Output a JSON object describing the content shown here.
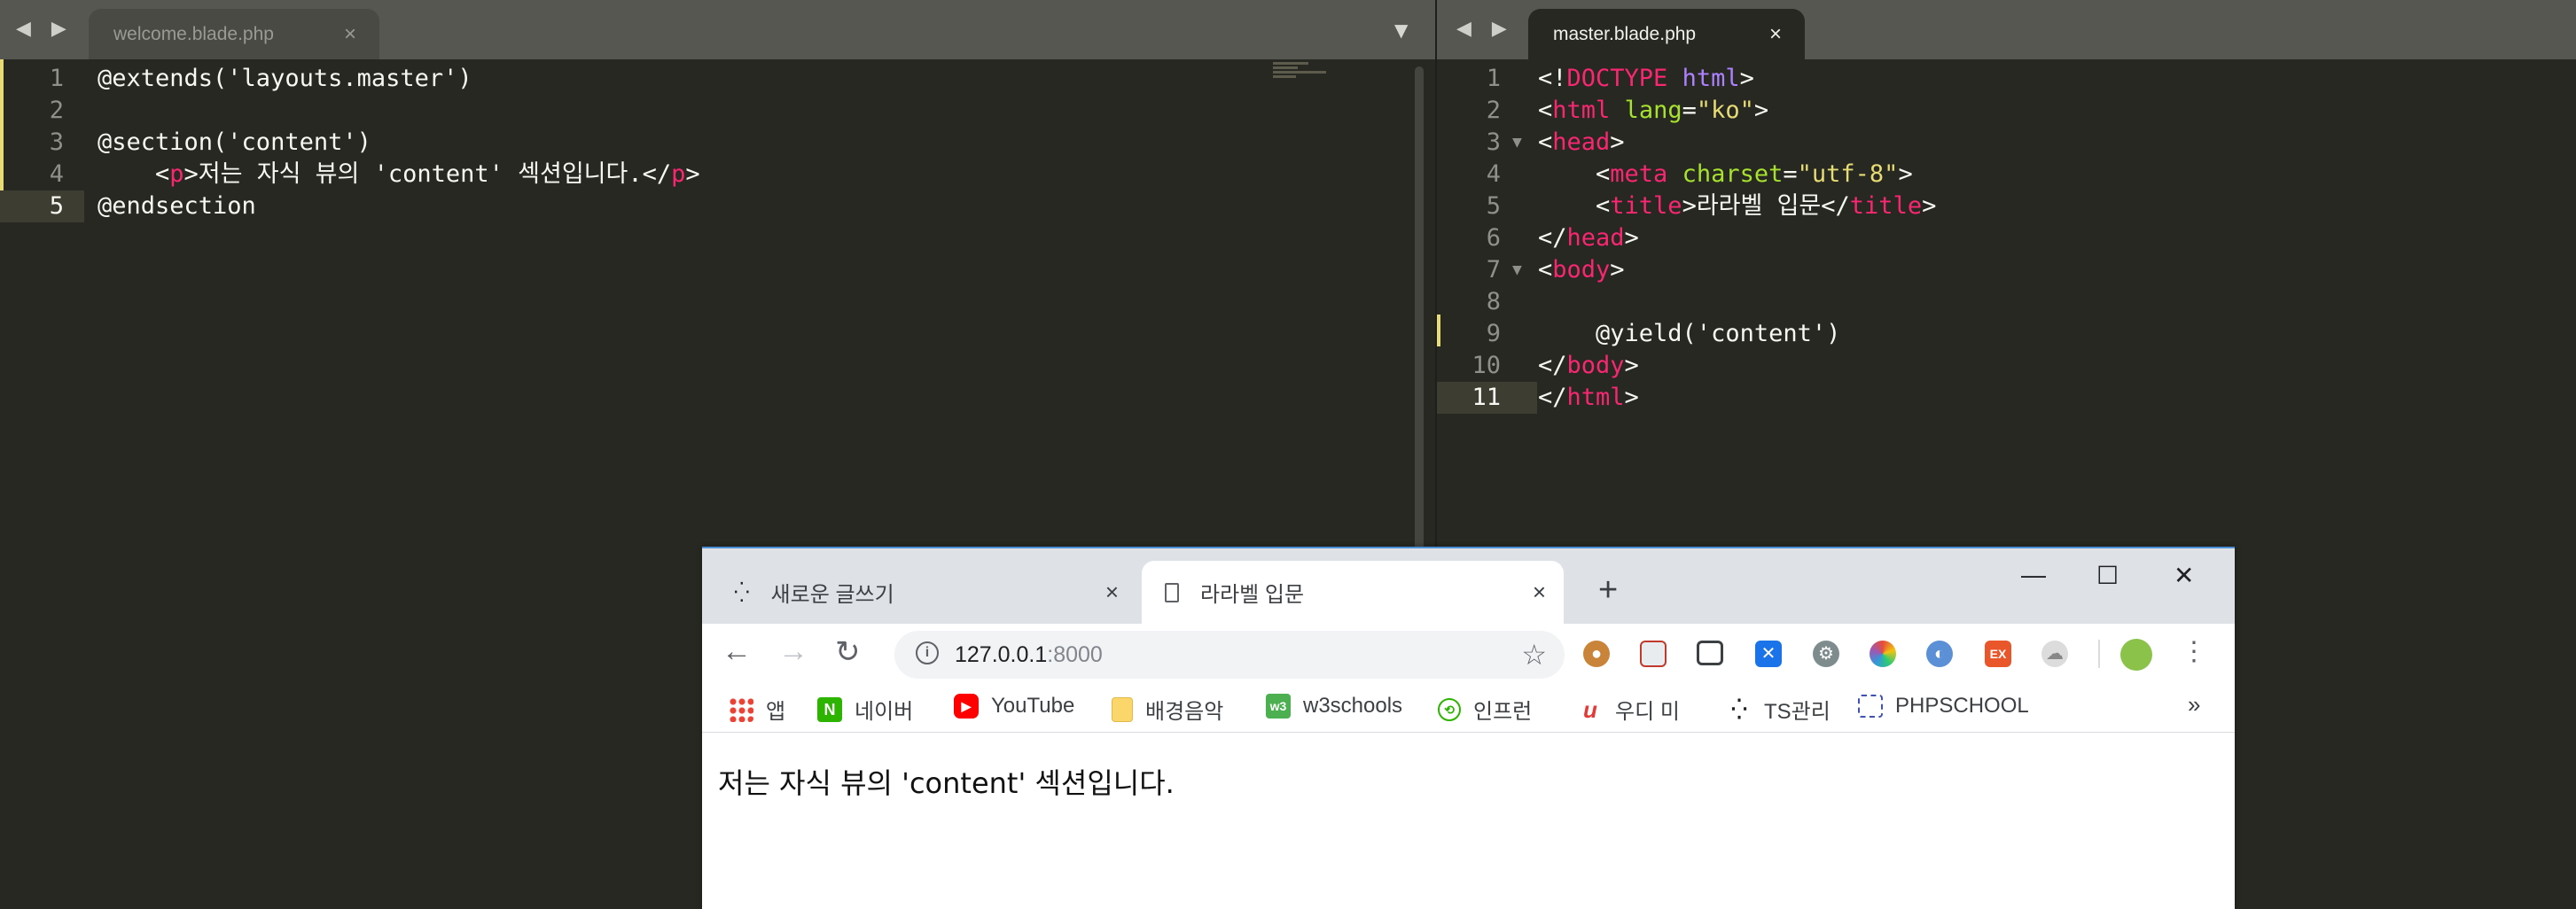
{
  "editor_left": {
    "tab": {
      "name": "welcome.blade.php",
      "close": "×"
    },
    "nav_arrows": "◀ ▶",
    "lines": [
      {
        "num": "1",
        "segments": [
          {
            "text": "@extends('layouts.master')",
            "kind": "plain"
          }
        ]
      },
      {
        "num": "2",
        "segments": []
      },
      {
        "num": "3",
        "segments": [
          {
            "text": "@section('content')",
            "kind": "plain"
          }
        ]
      },
      {
        "num": "4",
        "segments": [
          {
            "text": "    <",
            "kind": "plain"
          },
          {
            "text": "p",
            "kind": "tag"
          },
          {
            "text": ">저는 자식 뷰의 'content' 섹션입니다.</",
            "kind": "plain"
          },
          {
            "text": "p",
            "kind": "tag"
          },
          {
            "text": ">",
            "kind": "plain"
          }
        ]
      },
      {
        "num": "5",
        "segments": [
          {
            "text": "@endsection",
            "kind": "plain"
          }
        ]
      }
    ],
    "dropdown": "▼"
  },
  "editor_right": {
    "tab": {
      "name": "master.blade.php",
      "close": "×"
    },
    "nav_arrows": "◀ ▶",
    "lines": [
      {
        "num": "1",
        "segments": [
          {
            "text": "<!",
            "kind": "plain"
          },
          {
            "text": "DOCTYPE",
            "kind": "tag"
          },
          {
            "text": " ",
            "kind": "plain"
          },
          {
            "text": "html",
            "kind": "kw"
          },
          {
            "text": ">",
            "kind": "plain"
          }
        ]
      },
      {
        "num": "2",
        "segments": [
          {
            "text": "<",
            "kind": "plain"
          },
          {
            "text": "html",
            "kind": "tag"
          },
          {
            "text": " ",
            "kind": "plain"
          },
          {
            "text": "lang",
            "kind": "attr"
          },
          {
            "text": "=",
            "kind": "plain"
          },
          {
            "text": "\"ko\"",
            "kind": "str"
          },
          {
            "text": ">",
            "kind": "plain"
          }
        ]
      },
      {
        "num": "3",
        "fold": "▼",
        "segments": [
          {
            "text": "<",
            "kind": "plain"
          },
          {
            "text": "head",
            "kind": "tag"
          },
          {
            "text": ">",
            "kind": "plain"
          }
        ]
      },
      {
        "num": "4",
        "segments": [
          {
            "text": "    <",
            "kind": "plain"
          },
          {
            "text": "meta",
            "kind": "tag"
          },
          {
            "text": " ",
            "kind": "plain"
          },
          {
            "text": "charset",
            "kind": "attr"
          },
          {
            "text": "=",
            "kind": "plain"
          },
          {
            "text": "\"utf-8\"",
            "kind": "str"
          },
          {
            "text": ">",
            "kind": "plain"
          }
        ]
      },
      {
        "num": "5",
        "segments": [
          {
            "text": "    <",
            "kind": "plain"
          },
          {
            "text": "title",
            "kind": "tag"
          },
          {
            "text": ">라라벨 입문</",
            "kind": "plain"
          },
          {
            "text": "title",
            "kind": "tag"
          },
          {
            "text": ">",
            "kind": "plain"
          }
        ]
      },
      {
        "num": "6",
        "segments": [
          {
            "text": "</",
            "kind": "plain"
          },
          {
            "text": "head",
            "kind": "tag"
          },
          {
            "text": ">",
            "kind": "plain"
          }
        ]
      },
      {
        "num": "7",
        "fold": "▼",
        "segments": [
          {
            "text": "<",
            "kind": "plain"
          },
          {
            "text": "body",
            "kind": "tag"
          },
          {
            "text": ">",
            "kind": "plain"
          }
        ]
      },
      {
        "num": "8",
        "segments": []
      },
      {
        "num": "9",
        "segments": [
          {
            "text": "    @yield('content')",
            "kind": "plain"
          }
        ]
      },
      {
        "num": "10",
        "segments": [
          {
            "text": "</",
            "kind": "plain"
          },
          {
            "text": "body",
            "kind": "tag"
          },
          {
            "text": ">",
            "kind": "plain"
          }
        ]
      },
      {
        "num": "11",
        "segments": [
          {
            "text": "</",
            "kind": "plain"
          },
          {
            "text": "html",
            "kind": "tag"
          },
          {
            "text": ">",
            "kind": "plain"
          }
        ]
      }
    ]
  },
  "browser": {
    "tabs": [
      {
        "label": "새로운 글쓰기",
        "close": "×",
        "active": false
      },
      {
        "label": "라라벨 입문",
        "close": "×",
        "active": true
      }
    ],
    "new_tab": "+",
    "window_controls": {
      "minimize": "—",
      "maximize": "☐",
      "close": "✕"
    },
    "nav": {
      "back": "←",
      "forward": "→",
      "reload": "↻"
    },
    "url": {
      "host": "127.0.0.1",
      "port": ":8000"
    },
    "star": "☆",
    "menu": "⋮",
    "bookmarks": [
      {
        "label": "앱",
        "icon": "apps-icon"
      },
      {
        "label": "네이버",
        "icon": "naver-icon"
      },
      {
        "label": "YouTube",
        "icon": "youtube-icon"
      },
      {
        "label": "배경음악",
        "icon": "folder-icon"
      },
      {
        "label": "w3schools",
        "icon": "w3schools-icon"
      },
      {
        "label": "인프런",
        "icon": "inflearn-icon"
      },
      {
        "label": "우디 미",
        "icon": "woodi-icon"
      },
      {
        "label": "TS관리",
        "icon": "ts-icon"
      },
      {
        "label": "PHPSCHOOL",
        "icon": "phpschool-icon"
      }
    ],
    "more_bookmarks": "»",
    "page_text": "저는 자식 뷰의 'content' 섹션입니다."
  }
}
